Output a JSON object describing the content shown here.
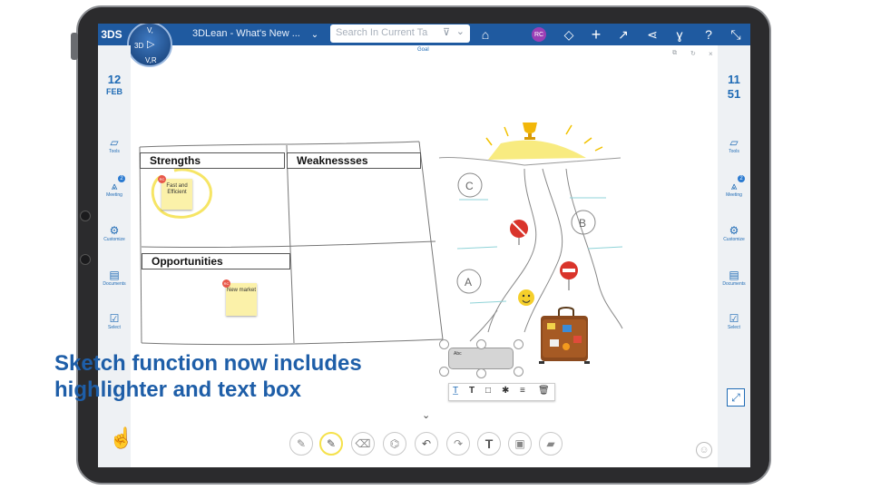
{
  "app": {
    "title": "3DLean - What's New ...",
    "compass_center": "3D",
    "compass_bottom": "V,R",
    "compass_top": "V,"
  },
  "search": {
    "placeholder": "Search In Current Ta"
  },
  "header": {
    "user_initials": "RC",
    "goal_label": "Goal",
    "icons": [
      "tag-icon",
      "sketch-icon",
      "plus-icon",
      "share-icon",
      "network-icon",
      "compass-icon",
      "help-icon",
      "collapse-icon"
    ]
  },
  "left_sidebar": {
    "day": "12",
    "month": "FEB",
    "items": [
      {
        "label": "Tools",
        "icon": "tools-icon"
      },
      {
        "label": "Meeting",
        "icon": "meeting-icon",
        "badge": "2"
      },
      {
        "label": "Customize",
        "icon": "gear-icon"
      },
      {
        "label": "Documents",
        "icon": "document-icon"
      },
      {
        "label": "Select",
        "icon": "select-icon"
      }
    ]
  },
  "right_sidebar": {
    "hour": "11",
    "minute": "51",
    "items": [
      {
        "label": "Tools",
        "icon": "tools-icon"
      },
      {
        "label": "Meeting",
        "icon": "meeting-icon",
        "badge": "2"
      },
      {
        "label": "Customize",
        "icon": "gear-icon"
      },
      {
        "label": "Documents",
        "icon": "document-icon"
      },
      {
        "label": "Select",
        "icon": "select-icon"
      }
    ]
  },
  "swot": {
    "strengths": "Strengths",
    "weaknesses": "Weaknessses",
    "opportunities": "Opportunities"
  },
  "notes": [
    {
      "text": "Fast and Efficient",
      "author": "RC"
    },
    {
      "text": "New market",
      "author": "RC"
    }
  ],
  "sketch_labels": {
    "a": "A",
    "b": "B",
    "c": "C"
  },
  "textbox": {
    "text": "Abc"
  },
  "caption": {
    "line1": "Sketch function now includes",
    "line2": "highlighter and text box"
  },
  "colors": {
    "accent": "#1f5aa0",
    "caption": "#1e5ea8",
    "highlighter": "#f5e14a",
    "note": "#fbf1a9"
  }
}
